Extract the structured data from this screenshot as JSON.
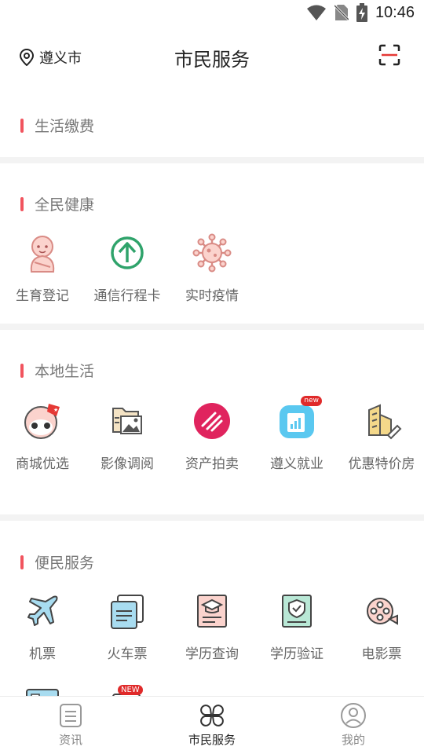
{
  "status": {
    "time": "10:46"
  },
  "header": {
    "location": "遵义市",
    "title": "市民服务"
  },
  "sections": {
    "life_payment": {
      "title": "生活缴费"
    },
    "health": {
      "title": "全民健康",
      "items": [
        {
          "label": "生育登记",
          "icon": "baby-icon"
        },
        {
          "label": "通信行程卡",
          "icon": "arrow-up-circle-icon"
        },
        {
          "label": "实时疫情",
          "icon": "virus-icon"
        }
      ]
    },
    "local": {
      "title": "本地生活",
      "items": [
        {
          "label": "商城优选",
          "icon": "panda-mall-icon"
        },
        {
          "label": "影像调阅",
          "icon": "folder-image-icon"
        },
        {
          "label": "资产拍卖",
          "icon": "auction-icon"
        },
        {
          "label": "遵义就业",
          "icon": "employment-icon",
          "badge": "new"
        },
        {
          "label": "优惠特价房",
          "icon": "building-icon"
        }
      ]
    },
    "convenience": {
      "title": "便民服务",
      "items": [
        {
          "label": "机票",
          "icon": "airplane-icon"
        },
        {
          "label": "火车票",
          "icon": "train-ticket-icon"
        },
        {
          "label": "学历查询",
          "icon": "graduation-cap-icon"
        },
        {
          "label": "学历验证",
          "icon": "shield-certificate-icon"
        },
        {
          "label": "电影票",
          "icon": "film-reel-icon"
        }
      ],
      "partial_badge": "NEW"
    }
  },
  "tabs": [
    {
      "label": "资讯",
      "icon": "news-icon"
    },
    {
      "label": "市民服务",
      "icon": "services-icon"
    },
    {
      "label": "我的",
      "icon": "profile-icon"
    }
  ]
}
